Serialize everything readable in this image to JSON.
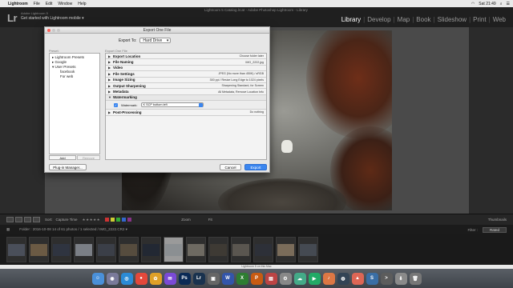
{
  "menubar": {
    "app": "Lightroom",
    "items": [
      "File",
      "Edit",
      "Window",
      "Help"
    ],
    "clock": "Sat 21:49"
  },
  "lr": {
    "window_title": "Lightroom 5 Catalog.lrcat - Adobe Photoshop Lightroom - Library",
    "logo": "Lr",
    "product": "Adobe Lightroom 5",
    "subtitle": "Get started with Lightroom mobile ▾",
    "modules": [
      "Library",
      "Develop",
      "Map",
      "Book",
      "Slideshow",
      "Print",
      "Web"
    ],
    "active_module": "Library"
  },
  "dialog": {
    "title": "Export One File",
    "export_to_label": "Export To:",
    "export_to_value": "Hard Drive",
    "presets_label": "Preset:",
    "preset_name": "Export One File",
    "presets": [
      {
        "label": "Lightroom Presets",
        "expanded": false,
        "level": 0
      },
      {
        "label": "Google",
        "expanded": false,
        "level": 0
      },
      {
        "label": "User Presets",
        "expanded": true,
        "level": 0
      },
      {
        "label": "facebook",
        "level": 1
      },
      {
        "label": "For web",
        "level": 1
      }
    ],
    "add_label": "Add",
    "remove_label": "Remove",
    "sections": [
      {
        "name": "Export Location",
        "value": "Choose folder later",
        "open": false
      },
      {
        "name": "File Naming",
        "value": "IMG_2222.jpg",
        "open": false
      },
      {
        "name": "Video",
        "value": "",
        "open": false
      },
      {
        "name": "File Settings",
        "value": "JPEG (No more than 450K) / sRGB",
        "open": false
      },
      {
        "name": "Image Sizing",
        "value": "300 ppi / Resize Long Edge to 1024 pixels",
        "open": false
      },
      {
        "name": "Output Sharpening",
        "value": "Sharpening Standard, for Screen",
        "open": false
      },
      {
        "name": "Metadata",
        "value": "All Metadata, Remove Location Info",
        "open": false
      },
      {
        "name": "Watermarking",
        "value": "",
        "open": true
      }
    ],
    "watermark": {
      "checkbox_label": "Watermark:",
      "checked": true,
      "value": "K SCP bottom left"
    },
    "post_processing": {
      "name": "Post-Processing",
      "value": "Do nothing"
    },
    "plugin_manager_label": "Plug-in Manager...",
    "cancel_label": "Cancel",
    "export_label": "Export"
  },
  "toolbar": {
    "sort_label": "Sort:",
    "sort_value": "Capture Time",
    "thumbnails_label": "Thumbnails"
  },
  "filmstrip": {
    "info": "Folder : 2016-10-08    14 of 61 photos / 1 selected / IMG_2222.CR2 ▾",
    "filter_label": "Filter :",
    "filter_value": "Rated",
    "thumb_count": 14,
    "selected_index": 7
  },
  "status": "Lightroom 5 on this Mac",
  "colors": {
    "accent": "#3b86ef",
    "dialog_bg": "#e6e6e6",
    "lr_bg": "#1f1f1f"
  }
}
